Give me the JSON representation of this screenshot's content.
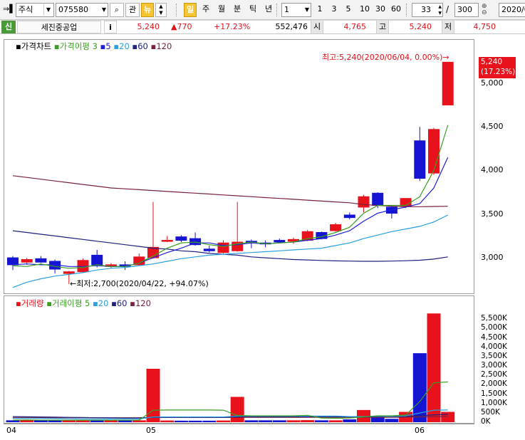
{
  "toolbar": {
    "market_select": "주식",
    "code_input": "075580",
    "btn_gwan": "관",
    "btn_new": "뉴",
    "periods": [
      "일",
      "주",
      "월",
      "분",
      "틱",
      "년"
    ],
    "period_count": "1",
    "counts": [
      "1",
      "3",
      "5",
      "10",
      "30",
      "60"
    ],
    "visible_count": "33",
    "slash": "/",
    "total_count": "300",
    "date_input": "2020/0"
  },
  "quote": {
    "credit_flag": "신",
    "stock_name": "세진중공업",
    "info_icon": "i",
    "price": "5,240",
    "change": "▲770",
    "change_pct": "+17.23%",
    "volume": "552,476",
    "open_label": "시",
    "open": "4,765",
    "high_label": "고",
    "high": "5,240",
    "low_label": "저",
    "low": "4,750"
  },
  "price_chart": {
    "legend_title": "가격차트",
    "legend_ma_label": "가격이평",
    "legend_ma_periods": [
      "3",
      "5",
      "20",
      "60",
      "120"
    ],
    "high_annotation": "최고:5,240(2020/06/04, 0.00%)→",
    "low_annotation": "←최저:2,700(2020/04/22, +94.07%)",
    "current_price": "5,240",
    "current_pct": "(17.23%)",
    "y_ticks": [
      "5,000",
      "4,500",
      "4,000",
      "3,500",
      "3,000"
    ]
  },
  "volume_chart": {
    "legend_title": "거래량",
    "legend_ma_label": "거래이평",
    "legend_ma_periods": [
      "5",
      "20",
      "60",
      "120"
    ],
    "y_ticks": [
      "5,500K",
      "5,000K",
      "4,500K",
      "4,000K",
      "3,500K",
      "3,000K",
      "2,500K",
      "2,000K",
      "1,500K",
      "1,000K",
      "500K",
      "0K"
    ]
  },
  "x_ticks": [
    "04",
    "05",
    "06"
  ],
  "colors": {
    "up": "#e8121c",
    "down": "#1414d2",
    "ma3": "#3aa020",
    "ma5": "#2020d8",
    "ma20": "#2aa0e0",
    "ma60": "#202080",
    "ma120": "#7a2040"
  },
  "chart_data": {
    "type": "candlestick",
    "x_axis_labels": [
      "04",
      "05",
      "06"
    ],
    "ylim": [
      2650,
      5300
    ],
    "candles": [
      {
        "o": 3000,
        "h": 3020,
        "l": 2860,
        "c": 2920
      },
      {
        "o": 2950,
        "h": 3000,
        "l": 2920,
        "c": 2980
      },
      {
        "o": 2990,
        "h": 3020,
        "l": 2940,
        "c": 2950
      },
      {
        "o": 2960,
        "h": 2980,
        "l": 2820,
        "c": 2870
      },
      {
        "o": 2820,
        "h": 2850,
        "l": 2700,
        "c": 2840
      },
      {
        "o": 2840,
        "h": 2990,
        "l": 2830,
        "c": 2970
      },
      {
        "o": 3030,
        "h": 3090,
        "l": 2890,
        "c": 2920
      },
      {
        "o": 2900,
        "h": 2940,
        "l": 2880,
        "c": 2920
      },
      {
        "o": 2920,
        "h": 2960,
        "l": 2860,
        "c": 2900
      },
      {
        "o": 2920,
        "h": 3050,
        "l": 2910,
        "c": 3010
      },
      {
        "o": 3000,
        "h": 3640,
        "l": 2990,
        "c": 3120
      },
      {
        "o": 3200,
        "h": 3250,
        "l": 3180,
        "c": 3200
      },
      {
        "o": 3240,
        "h": 3260,
        "l": 3180,
        "c": 3200
      },
      {
        "o": 3220,
        "h": 3290,
        "l": 3140,
        "c": 3150
      },
      {
        "o": 3100,
        "h": 3140,
        "l": 3060,
        "c": 3080
      },
      {
        "o": 3060,
        "h": 3200,
        "l": 3050,
        "c": 3170
      },
      {
        "o": 3080,
        "h": 3640,
        "l": 3070,
        "c": 3180
      },
      {
        "o": 3190,
        "h": 3210,
        "l": 3110,
        "c": 3180
      },
      {
        "o": 3170,
        "h": 3200,
        "l": 3120,
        "c": 3160
      },
      {
        "o": 3200,
        "h": 3220,
        "l": 3170,
        "c": 3180
      },
      {
        "o": 3190,
        "h": 3230,
        "l": 3160,
        "c": 3210
      },
      {
        "o": 3200,
        "h": 3320,
        "l": 3190,
        "c": 3300
      },
      {
        "o": 3290,
        "h": 3300,
        "l": 3210,
        "c": 3220
      },
      {
        "o": 3310,
        "h": 3400,
        "l": 3300,
        "c": 3380
      },
      {
        "o": 3490,
        "h": 3520,
        "l": 3440,
        "c": 3460
      },
      {
        "o": 3580,
        "h": 3720,
        "l": 3520,
        "c": 3700
      },
      {
        "o": 3740,
        "h": 3750,
        "l": 3570,
        "c": 3600
      },
      {
        "o": 3580,
        "h": 3600,
        "l": 3450,
        "c": 3510
      },
      {
        "o": 3590,
        "h": 3680,
        "l": 3570,
        "c": 3680
      },
      {
        "o": 4340,
        "h": 4500,
        "l": 3880,
        "c": 3910
      },
      {
        "o": 3970,
        "h": 4490,
        "l": 3950,
        "c": 4470
      },
      {
        "o": 4750,
        "h": 5240,
        "l": 4750,
        "c": 5240
      }
    ],
    "ma3": [
      2910,
      2900,
      2930,
      2900,
      2880,
      2890,
      2920,
      2900,
      2900,
      2940,
      3020,
      3110,
      3170,
      3180,
      3150,
      3130,
      3160,
      3180,
      3160,
      3170,
      3180,
      3220,
      3240,
      3290,
      3350,
      3510,
      3600,
      3600,
      3600,
      3700,
      4000,
      4520
    ],
    "ma5": [
      2920,
      2930,
      2920,
      2920,
      2900,
      2900,
      2910,
      2900,
      2900,
      2940,
      3000,
      3060,
      3110,
      3170,
      3170,
      3140,
      3150,
      3170,
      3160,
      3170,
      3180,
      3200,
      3220,
      3260,
      3310,
      3420,
      3510,
      3550,
      3580,
      3620,
      3800,
      4150
    ],
    "ma20": [
      2660,
      2720,
      2760,
      2790,
      2810,
      2830,
      2860,
      2880,
      2890,
      2910,
      2930,
      2960,
      2990,
      3010,
      3030,
      3040,
      3050,
      3060,
      3070,
      3080,
      3090,
      3100,
      3110,
      3140,
      3170,
      3220,
      3260,
      3300,
      3330,
      3360,
      3410,
      3490
    ],
    "ma60": [
      3310,
      3290,
      3270,
      3250,
      3230,
      3210,
      3190,
      3170,
      3150,
      3130,
      3110,
      3100,
      3080,
      3070,
      3050,
      3040,
      3030,
      3010,
      3000,
      2990,
      2980,
      2975,
      2970,
      2965,
      2962,
      2960,
      2960,
      2962,
      2966,
      2972,
      2985,
      3010
    ],
    "ma120": [
      3940,
      3920,
      3900,
      3880,
      3860,
      3840,
      3820,
      3800,
      3790,
      3780,
      3770,
      3760,
      3750,
      3740,
      3730,
      3720,
      3710,
      3700,
      3690,
      3680,
      3670,
      3660,
      3650,
      3640,
      3630,
      3610,
      3600,
      3590,
      3585,
      3585,
      3588,
      3590
    ],
    "volume_ylim": [
      0,
      6000
    ],
    "volume": [
      100,
      110,
      100,
      100,
      100,
      110,
      100,
      100,
      100,
      100,
      2850,
      90,
      80,
      80,
      80,
      90,
      1350,
      100,
      100,
      100,
      100,
      110,
      100,
      100,
      150,
      650,
      300,
      180,
      550,
      3680,
      5800,
      552
    ],
    "vol_ma5": [
      110,
      120,
      110,
      105,
      105,
      105,
      105,
      105,
      105,
      105,
      640,
      650,
      650,
      650,
      650,
      640,
      360,
      340,
      340,
      340,
      340,
      370,
      220,
      210,
      220,
      280,
      340,
      340,
      380,
      1100,
      2100,
      2150
    ],
    "vol_ma20": [
      200,
      200,
      200,
      190,
      180,
      170,
      170,
      170,
      170,
      170,
      280,
      280,
      280,
      280,
      280,
      280,
      330,
      330,
      330,
      330,
      330,
      330,
      330,
      330,
      300,
      300,
      320,
      320,
      340,
      490,
      640,
      650
    ],
    "vol_ma60": [
      300,
      290,
      280,
      270,
      260,
      250,
      240,
      230,
      220,
      220,
      260,
      260,
      260,
      260,
      260,
      260,
      290,
      290,
      290,
      290,
      290,
      290,
      290,
      290,
      290,
      290,
      300,
      300,
      310,
      340,
      390,
      420
    ],
    "vol_ma120": [
      240,
      240,
      240,
      240,
      240,
      240,
      240,
      240,
      240,
      240,
      250,
      250,
      250,
      250,
      250,
      250,
      260,
      260,
      260,
      260,
      260,
      260,
      260,
      260,
      260,
      260,
      260,
      260,
      270,
      280,
      300,
      310
    ]
  }
}
